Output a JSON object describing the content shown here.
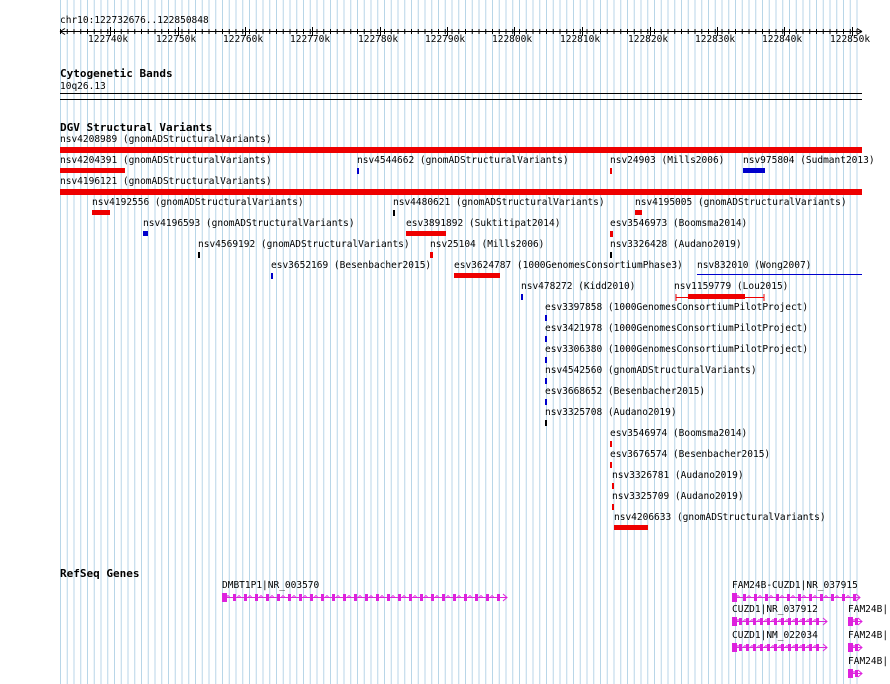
{
  "ruler": {
    "locus": "chr10:122732676..122850848",
    "ticks": [
      "122740k",
      "122750k",
      "122760k",
      "122770k",
      "122780k",
      "122790k",
      "122800k",
      "122810k",
      "122820k",
      "122830k",
      "122840k",
      "122850k"
    ]
  },
  "cyto": {
    "title": "Cytogenetic Bands",
    "band": "10q26.13"
  },
  "dgv": {
    "title": "DGV Structural Variants",
    "colors": {
      "loss": "#ee0000",
      "gain": "#0000cc",
      "other": "#000000"
    },
    "features": [
      {
        "label": "nsv4208989 (gnomADStructuralVariants)"
      },
      {
        "label": "nsv4204391 (gnomADStructuralVariants)"
      },
      {
        "label": "nsv4544662 (gnomADStructuralVariants)"
      },
      {
        "label": "nsv24903 (Mills2006)"
      },
      {
        "label": "nsv975804 (Sudmant2013)"
      },
      {
        "label": "nsv4196121 (gnomADStructuralVariants)"
      },
      {
        "label": "nsv4192556 (gnomADStructuralVariants)"
      },
      {
        "label": "nsv4480621 (gnomADStructuralVariants)"
      },
      {
        "label": "nsv4195005 (gnomADStructuralVariants)"
      },
      {
        "label": "nsv4196593 (gnomADStructuralVariants)"
      },
      {
        "label": "esv3891892 (Suktitipat2014)"
      },
      {
        "label": "esv3546973 (Boomsma2014)"
      },
      {
        "label": "nsv4569192 (gnomADStructuralVariants)"
      },
      {
        "label": "nsv25104 (Mills2006)"
      },
      {
        "label": "nsv3326428 (Audano2019)"
      },
      {
        "label": "esv3652169 (Besenbacher2015)"
      },
      {
        "label": "esv3624787 (1000GenomesConsortiumPhase3)"
      },
      {
        "label": "nsv832010 (Wong2007)"
      },
      {
        "label": "nsv478272 (Kidd2010)"
      },
      {
        "label": "nsv1159779 (Lou2015)"
      },
      {
        "label": "esv3397858 (1000GenomesConsortiumPilotProject)"
      },
      {
        "label": "esv3421978 (1000GenomesConsortiumPilotProject)"
      },
      {
        "label": "esv3306380 (1000GenomesConsortiumPilotProject)"
      },
      {
        "label": "nsv4542560 (gnomADStructuralVariants)"
      },
      {
        "label": "esv3668652 (Besenbacher2015)"
      },
      {
        "label": "nsv3325708 (Audano2019)"
      },
      {
        "label": "esv3546974 (Boomsma2014)"
      },
      {
        "label": "esv3676574 (Besenbacher2015)"
      },
      {
        "label": "nsv3326781 (Audano2019)"
      },
      {
        "label": "nsv3325709 (Audano2019)"
      },
      {
        "label": "nsv4206633 (gnomADStructuralVariants)"
      }
    ]
  },
  "genes": {
    "title": "RefSeq Genes",
    "color": "#dd22dd",
    "items": [
      {
        "label": "DMBT1P1|NR_003570"
      },
      {
        "label": "FAM24B-CUZD1|NR_037915"
      },
      {
        "label": "CUZD1|NR_037912"
      },
      {
        "label": "CUZD1|NM_022034"
      },
      {
        "label": "FAM24B|"
      },
      {
        "label": "FAM24B|"
      },
      {
        "label": "FAM24B|"
      }
    ]
  }
}
